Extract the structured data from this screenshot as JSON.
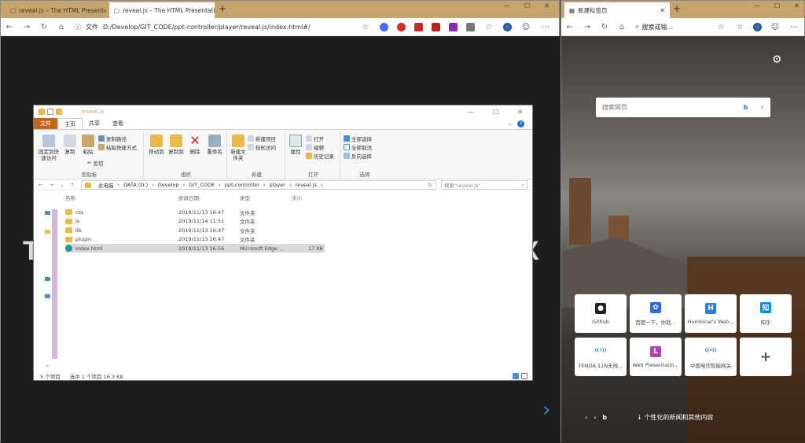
{
  "left_browser": {
    "tabs": [
      {
        "title": "reveal.js – The HTML Presentatio"
      },
      {
        "title": "reveal.js – The HTML Presentatio"
      }
    ],
    "window_controls": [
      "—",
      "☐",
      "✕"
    ],
    "address_label": "文件",
    "url": "D:/Develop/GIT_CODE/ppt-controller/player/reveal.js/index.html#/",
    "slide_text_left": "T",
    "slide_text_right": "X",
    "next_arrow": "›"
  },
  "explorer": {
    "title": "reveal.js",
    "title_buttons": [
      "—",
      "☐",
      "✕"
    ],
    "ribbon_tabs": [
      "文件",
      "主页",
      "共享",
      "查看"
    ],
    "groups": {
      "clipboard": {
        "label": "剪贴板",
        "pin": "固定到快速访问",
        "copy": "复制",
        "paste": "粘贴",
        "copy_path": "复制路径",
        "paste_shortcut": "粘贴快捷方式",
        "cut": "剪切"
      },
      "organize": {
        "label": "组织",
        "move_to": "移动到",
        "copy_to": "复制到",
        "delete": "删除",
        "rename": "重命名"
      },
      "new": {
        "label": "新建",
        "new_folder": "新建文件夹",
        "new_item": "新建项目",
        "easy_access": "轻松访问"
      },
      "open": {
        "label": "打开",
        "properties": "属性",
        "open": "打开",
        "edit": "编辑",
        "history": "历史记录"
      },
      "select": {
        "label": "选择",
        "select_all": "全部选择",
        "select_none": "全部取消",
        "invert": "反向选择"
      }
    },
    "breadcrumb": [
      "此电脑",
      "DATA (D:)",
      "Develop",
      "GIT_CODE",
      "ppt-controller",
      "player",
      "reveal.js"
    ],
    "search_placeholder": "搜索\"reveal.js\"",
    "columns": [
      "名称",
      "修改日期",
      "类型",
      "大小"
    ],
    "files": [
      {
        "name": "css",
        "date": "2019/11/13 16:47",
        "type": "文件夹",
        "size": "",
        "kind": "folder"
      },
      {
        "name": "js",
        "date": "2019/11/14 11:51",
        "type": "文件夹",
        "size": "",
        "kind": "folder"
      },
      {
        "name": "lib",
        "date": "2019/11/13 16:47",
        "type": "文件夹",
        "size": "",
        "kind": "folder"
      },
      {
        "name": "plugin",
        "date": "2019/11/13 16:47",
        "type": "文件夹",
        "size": "",
        "kind": "folder"
      },
      {
        "name": "index.html",
        "date": "2019/11/13 16:56",
        "type": "Microsoft Edge ...",
        "size": "17 KB",
        "kind": "edge"
      }
    ],
    "status_count": "5 个项目",
    "status_selected": "选中 1 个项目  16.3 KB"
  },
  "right_browser": {
    "tab_title": "新建标签页",
    "search_placeholder": "搜索或输...",
    "page_search_placeholder": "搜索网页",
    "tiles": [
      {
        "label": "Github",
        "icon": "github-icon",
        "color": "#222222",
        "glyph": "●"
      },
      {
        "label": "百度一下，你就...",
        "icon": "baidu-icon",
        "color": "#2f6be0",
        "glyph": "✿"
      },
      {
        "label": "Humbinal's Web...",
        "icon": "h-icon",
        "color": "#2a7de1",
        "glyph": "H"
      },
      {
        "label": "知乎",
        "icon": "zhihu-icon",
        "color": "#0f88eb",
        "glyph": "知"
      },
      {
        "label": "TENDA 11N无线...",
        "icon": "wifi-icon",
        "color": "#ffffff",
        "glyph": "((•))"
      },
      {
        "label": "Web Presentatio...",
        "icon": "l-icon",
        "color": "#b33fb5",
        "glyph": "L"
      },
      {
        "label": "中国电信智能网关",
        "icon": "wifi-icon",
        "color": "#ffffff",
        "glyph": "((•))"
      },
      {
        "label": "",
        "icon": "add-icon",
        "color": "#ffffff",
        "glyph": "+"
      }
    ],
    "news_link": "↓  个性化的新闻和其他内容"
  }
}
